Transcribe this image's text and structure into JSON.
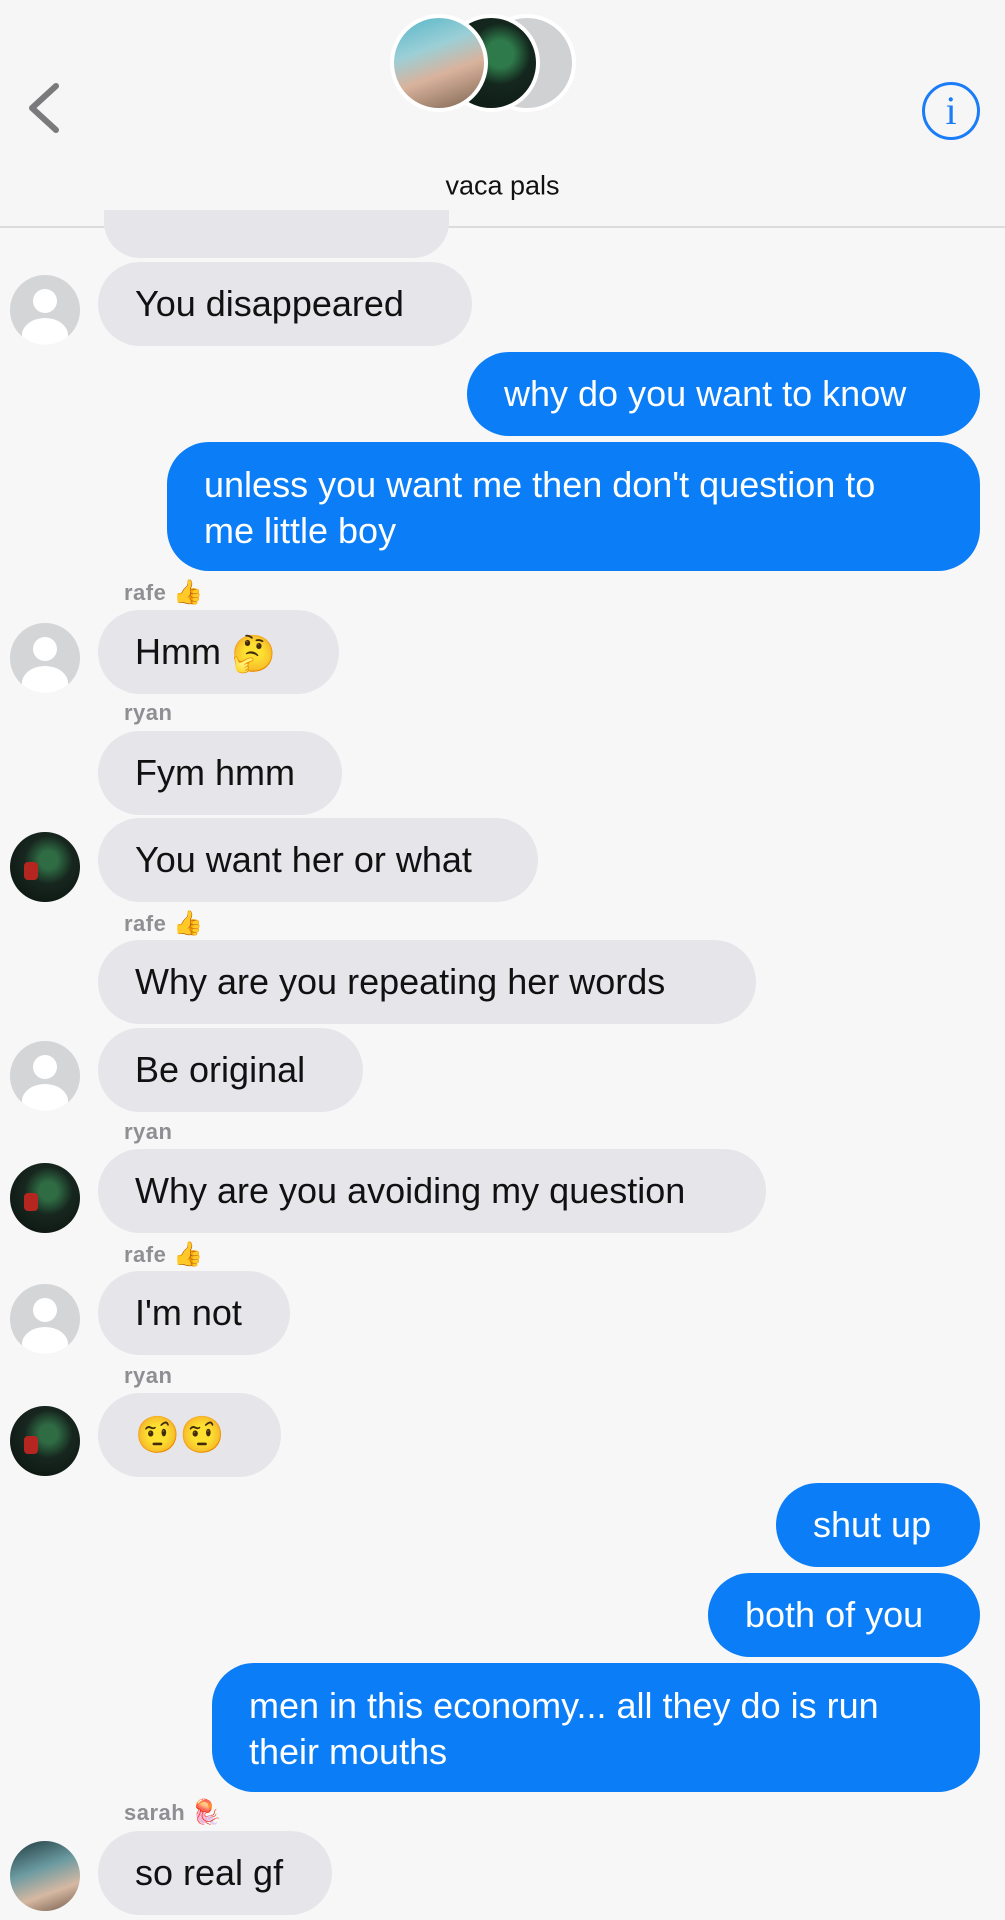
{
  "header": {
    "title": "vaca pals",
    "info_glyph": "i",
    "back_icon": "chevron-left-icon",
    "accent": "#1a7cf7"
  },
  "colors": {
    "outgoing_bubble": "#0a7df7",
    "incoming_bubble": "#e6e5ea",
    "background": "#f7f7f7"
  },
  "messages": [
    {
      "dir": "in",
      "text": "You disappeared"
    },
    {
      "dir": "out",
      "text": "why do you want to know"
    },
    {
      "dir": "out",
      "text": "unless you want me then don't question to",
      "text2": "me little boy"
    },
    {
      "dir": "in",
      "sender": "rafe",
      "sender_emoji": "👍",
      "text": "Hmm",
      "emoji": "🤔"
    },
    {
      "dir": "in",
      "sender": "ryan",
      "text": "Fym hmm"
    },
    {
      "dir": "in",
      "text": "You want her or what"
    },
    {
      "dir": "in",
      "sender": "rafe",
      "sender_emoji": "👍",
      "text": "Why are you repeating her words"
    },
    {
      "dir": "in",
      "text": "Be original"
    },
    {
      "dir": "in",
      "sender": "ryan",
      "text": "Why are you avoiding my question"
    },
    {
      "dir": "in",
      "sender": "rafe",
      "sender_emoji": "👍",
      "text": "I'm not"
    },
    {
      "dir": "in",
      "sender": "ryan",
      "text": "🤨🤨"
    },
    {
      "dir": "out",
      "text": "shut up"
    },
    {
      "dir": "out",
      "text": "both of you"
    },
    {
      "dir": "out",
      "text": "men in this economy... all they do is run",
      "text2": "their mouths"
    },
    {
      "dir": "in",
      "sender": "sarah",
      "sender_emoji": "🪼",
      "text": "so real gf"
    }
  ]
}
